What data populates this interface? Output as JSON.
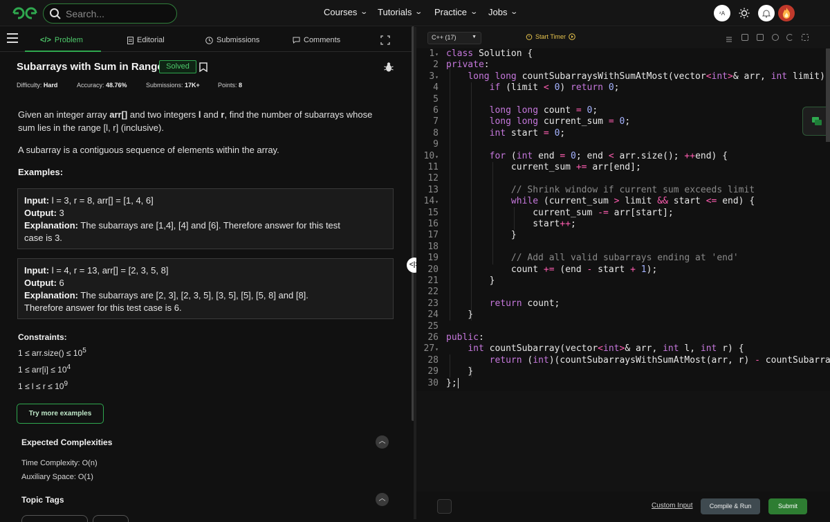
{
  "header": {
    "search_placeholder": "Search...",
    "nav": [
      "Courses",
      "Tutorials",
      "Practice",
      "Jobs"
    ]
  },
  "tabs": [
    "Problem",
    "Editorial",
    "Submissions",
    "Comments"
  ],
  "problem": {
    "title": "Subarrays with Sum in Range",
    "status": "Solved",
    "difficulty_label": "Difficulty:",
    "difficulty": "Hard",
    "accuracy_label": "Accuracy:",
    "accuracy": "48.76%",
    "submissions_label": "Submissions:",
    "submissions": "17K+",
    "points_label": "Points:",
    "points": "8",
    "desc1_a": "Given an integer array ",
    "desc1_b": "arr[]",
    "desc1_c": " and two integers ",
    "desc1_d": "l",
    "desc1_e": " and ",
    "desc1_f": "r",
    "desc1_g": ", find the number of subarrays whose",
    "desc1_line2": "sum lies in the range [l, r] (inclusive).",
    "desc2": "A subarray is a contiguous sequence of elements within the array.",
    "examples_heading": "Examples:",
    "examples": [
      {
        "input_label": "Input:",
        "input": " l = 3, r = 8, arr[] = [1, 4, 6]",
        "output_label": "Output:",
        "output": " 3",
        "expl_label": "Explanation:",
        "expl1": " The subarrays are [1,4], [4] and [6]. Therefore answer for this test",
        "expl2": "case is 3."
      },
      {
        "input_label": "Input:",
        "input": " l = 4, r = 13, arr[] = [2, 3, 5, 8]",
        "output_label": "Output:",
        "output": " 6",
        "expl_label": "Explanation:",
        "expl1": " The subarrays are [2, 3], [2, 3, 5], [3, 5], [5], [5, 8] and [8].",
        "expl2": "Therefore answer for this test case is 6."
      }
    ],
    "constraints_heading": "Constraints:",
    "constraints": [
      {
        "text": "1 ≤ arr.size() ≤ 10",
        "exp": "5"
      },
      {
        "text": "1 ≤ arr[i] ≤ 10",
        "exp": "4"
      },
      {
        "text": "1 ≤ l ≤ r ≤ 10",
        "exp": "9"
      }
    ],
    "try_more": "Try more examples",
    "expected_heading": "Expected Complexities",
    "time_complexity": "Time Complexity: O(n)",
    "aux_space": "Auxiliary Space: O(1)",
    "topic_tags": "Topic Tags"
  },
  "editor": {
    "language": "C++ (17)",
    "timer_label": "Start Timer",
    "line_numbers": [
      "1",
      "2",
      "3",
      "4",
      "5",
      "6",
      "7",
      "8",
      "9",
      "10",
      "11",
      "12",
      "13",
      "14",
      "15",
      "16",
      "17",
      "18",
      "19",
      "20",
      "21",
      "22",
      "23",
      "24",
      "25",
      "26",
      "27",
      "28",
      "29",
      "30"
    ],
    "custom_input": "Custom Input",
    "compile_run": "Compile & Run",
    "submit": "Submit"
  },
  "colors": {
    "accent_green": "#2fa84f",
    "keyword": "#c678dd",
    "number": "#a5b3ff",
    "operator": "#ff5db1",
    "comment": "#8a8a8a"
  }
}
